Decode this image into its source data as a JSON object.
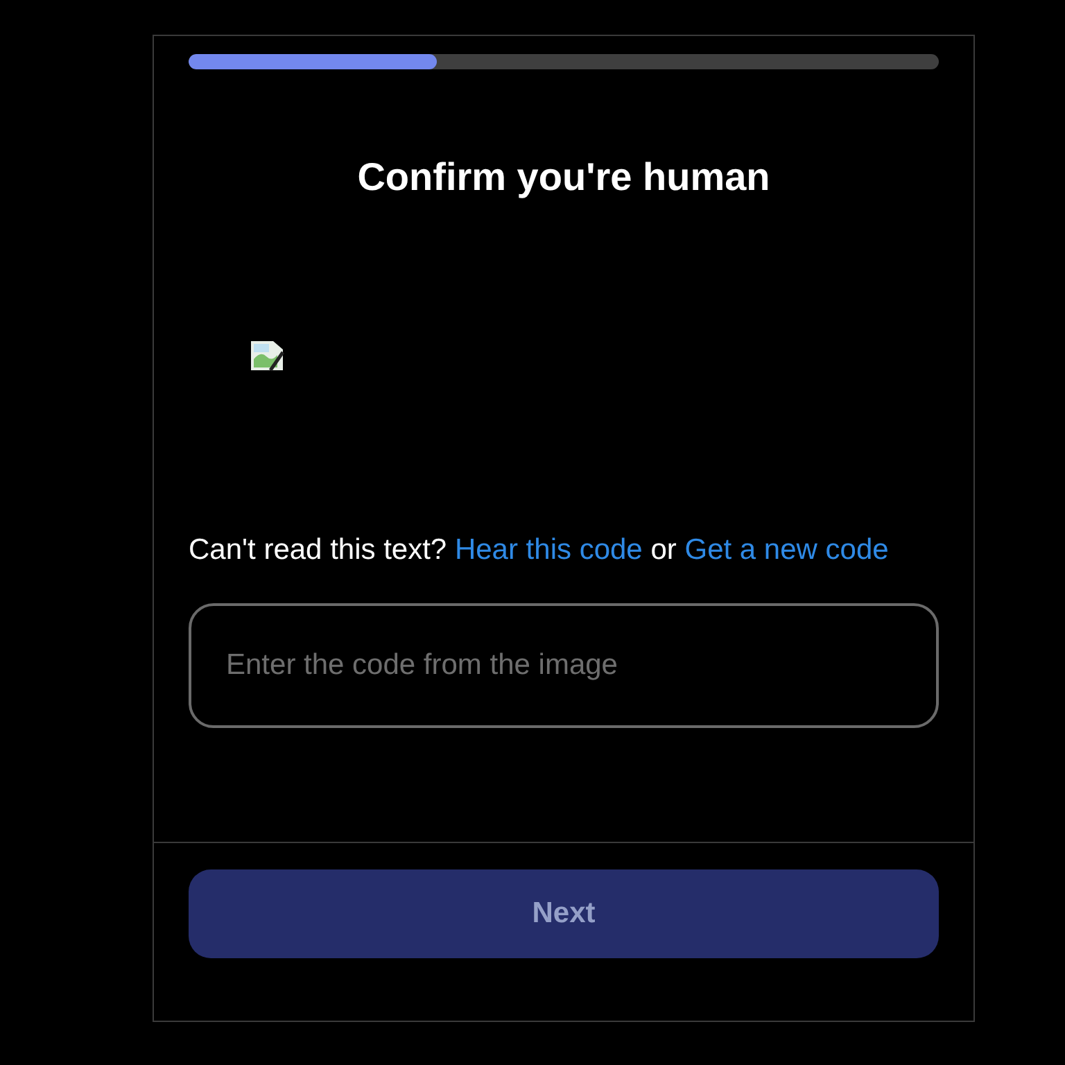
{
  "progress": {
    "level": 0.33
  },
  "title": "Confirm you're human",
  "help": [
    {
      "kind": "text",
      "text": "Can't read this text?"
    },
    {
      "kind": "link",
      "text": "Hear this code"
    },
    {
      "kind": "text",
      "text": "or"
    },
    {
      "kind": "link",
      "text": "Get a new code"
    }
  ],
  "code_field": {
    "placeholder": "Enter the code from the image"
  },
  "next_button": {
    "label": "Next",
    "disabled": true
  }
}
